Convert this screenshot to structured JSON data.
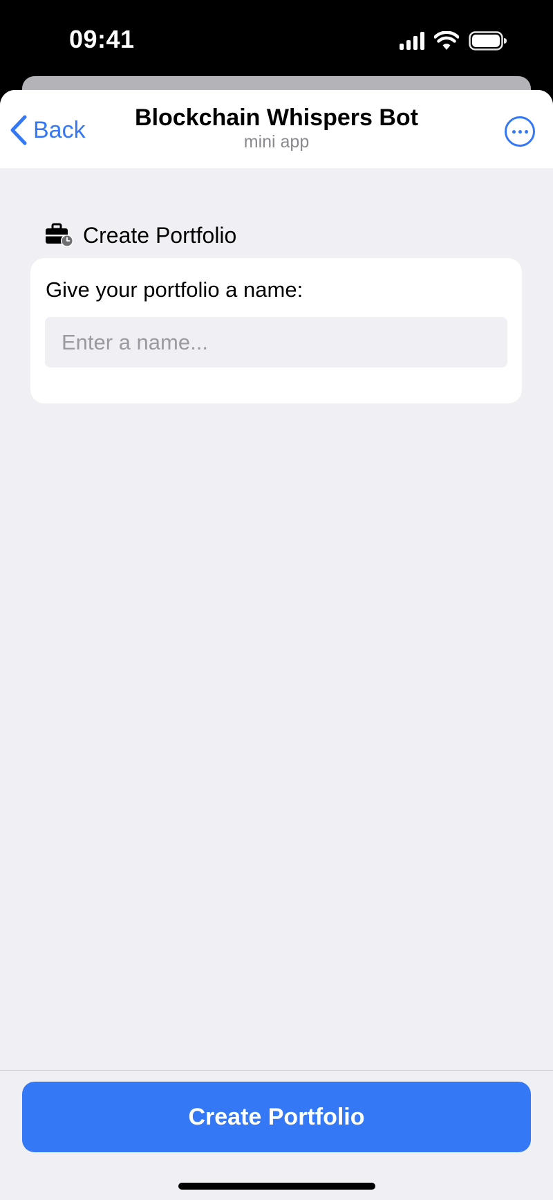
{
  "status_bar": {
    "time": "09:41",
    "icons": [
      "cellular-signal-icon",
      "wifi-icon",
      "battery-icon"
    ]
  },
  "header": {
    "back_label": "Back",
    "title": "Blockchain Whispers Bot",
    "subtitle": "mini app",
    "more_icon": "ellipsis-circle-icon"
  },
  "section": {
    "icon": "briefcase-clock-icon",
    "title": "Create Portfolio"
  },
  "form": {
    "label": "Give your portfolio a name:",
    "input_value": "",
    "input_placeholder": "Enter a name..."
  },
  "footer": {
    "button_label": "Create Portfolio"
  },
  "colors": {
    "accent": "#3478f6",
    "background": "#efeff4",
    "card": "#ffffff",
    "status_bar": "#000000"
  }
}
